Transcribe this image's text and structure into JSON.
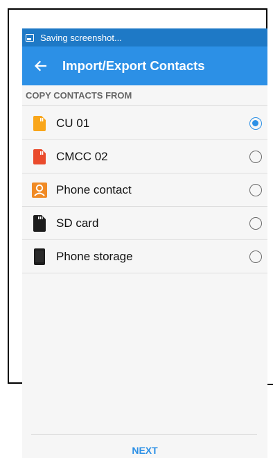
{
  "status_bar": {
    "notification_text": "Saving screenshot..."
  },
  "app_bar": {
    "title": "Import/Export Contacts",
    "back_icon": "arrow-left-icon"
  },
  "section": {
    "header": "COPY CONTACTS FROM"
  },
  "sources": [
    {
      "label": "CU 01",
      "icon": "sim-card-icon",
      "icon_color": "#f9a61a",
      "selected": true
    },
    {
      "label": "CMCC 02",
      "icon": "sim-card-icon",
      "icon_color": "#ea4b2c",
      "selected": false
    },
    {
      "label": "Phone contact",
      "icon": "contact-person-icon",
      "icon_color": "#f08a24",
      "selected": false
    },
    {
      "label": "SD card",
      "icon": "sd-card-icon",
      "icon_color": "#1c1c1c",
      "selected": false
    },
    {
      "label": "Phone storage",
      "icon": "phone-icon",
      "icon_color": "#1c1c1c",
      "selected": false
    }
  ],
  "footer": {
    "next_label": "NEXT"
  },
  "colors": {
    "accent": "#2c90e6",
    "status_bar": "#1e79c6"
  }
}
